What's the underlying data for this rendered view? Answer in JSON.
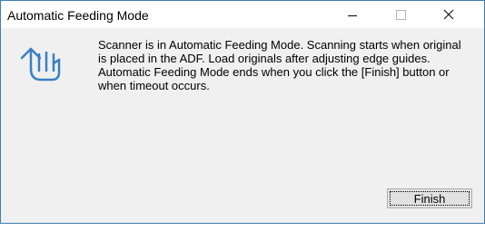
{
  "window": {
    "title": "Automatic Feeding Mode"
  },
  "titlebar": {
    "minimize_icon": "minimize-icon",
    "maximize_icon": "maximize-icon",
    "close_icon": "close-icon"
  },
  "dialog": {
    "icon": "automatic-feeding-hand-icon",
    "message": "Scanner is in Automatic Feeding Mode. Scanning starts when original is placed in the ADF. Load originals after adjusting edge guides. Automatic Feeding Mode ends when you click the [Finish] button or when timeout occurs.",
    "finish_label": "Finish"
  },
  "colors": {
    "accent": "#3a7fc1",
    "window_border": "#3c7fb1",
    "dialog_background": "#f0f0f0",
    "button_face": "#e1e1e1"
  }
}
